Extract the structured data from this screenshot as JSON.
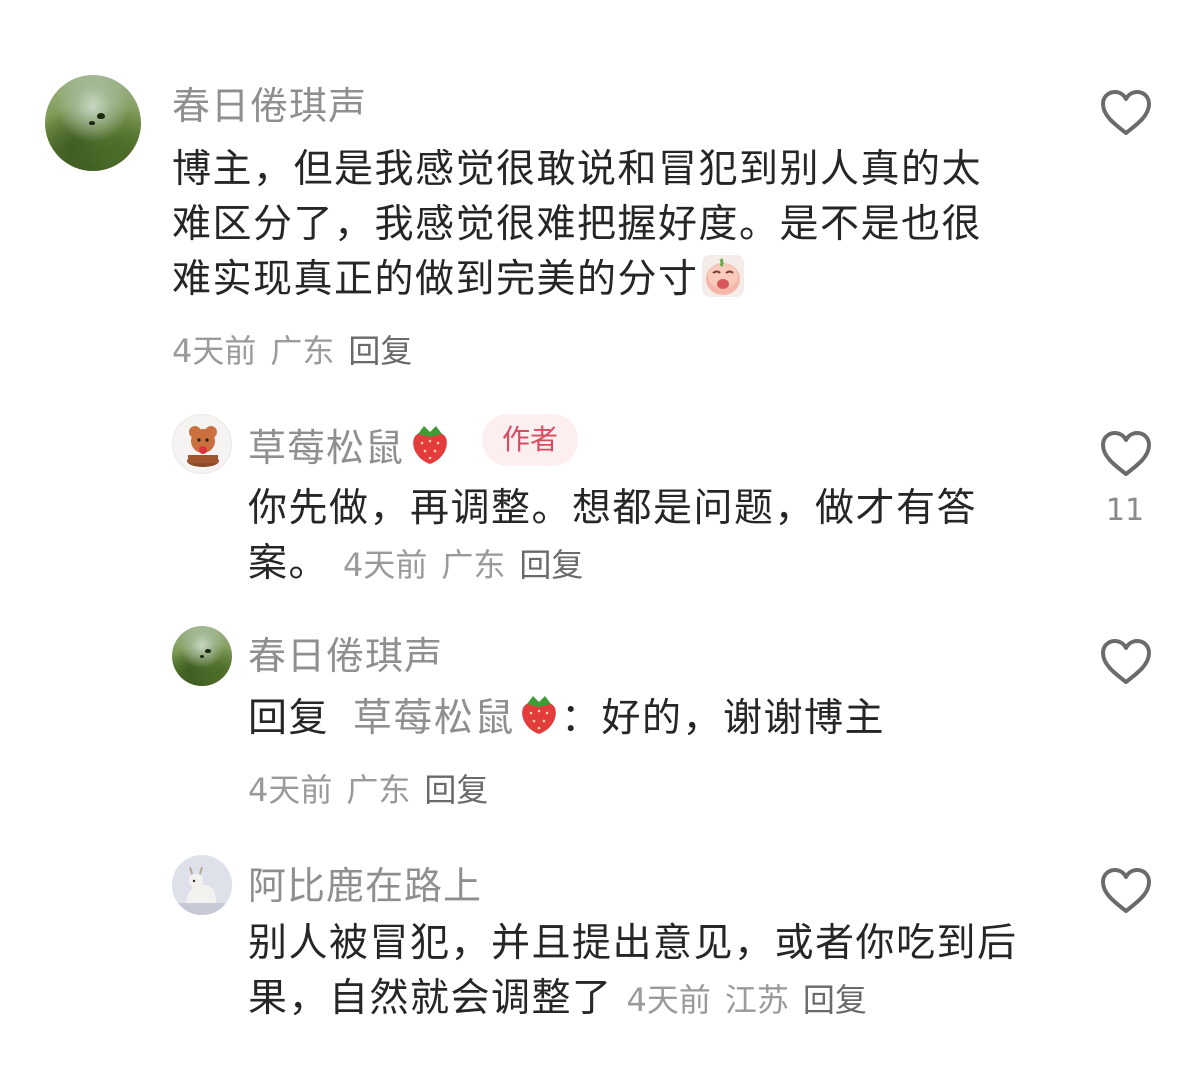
{
  "comments": [
    {
      "user": "春日倦琪声",
      "text": "博主，但是我感觉很敢说和冒犯到别人真的太难区分了，我感觉很难把握好度。是不是也很难实现真正的做到完美的分寸",
      "emoji_icon": "crying-peach-sticker-icon",
      "time": "4天前",
      "location": "广东",
      "reply_label": "回复",
      "likes": ""
    },
    {
      "user": "草莓松鼠",
      "user_emoji": "strawberry-icon",
      "badge": "作者",
      "text": "你先做，再调整。想都是问题，做才有答案。",
      "time": "4天前",
      "location": "广东",
      "reply_label": "回复",
      "likes": "11"
    },
    {
      "user": "春日倦琪声",
      "reply_prefix": "回复",
      "reply_target": "草莓松鼠",
      "reply_target_emoji": "strawberry-icon",
      "text": "：好的，谢谢博主",
      "time": "4天前",
      "location": "广东",
      "reply_label": "回复",
      "likes": ""
    },
    {
      "user": "阿比鹿在路上",
      "text": "别人被冒犯，并且提出意见，或者你吃到后果，自然就会调整了",
      "time": "4天前",
      "location": "江苏",
      "reply_label": "回复",
      "likes": ""
    }
  ],
  "icons": {
    "like": "heart-outline-icon"
  },
  "colors": {
    "username": "#8f8f8f",
    "text": "#262626",
    "meta": "#9a9a9a",
    "badge_bg": "#fdeef0",
    "badge_text": "#d94c60"
  }
}
